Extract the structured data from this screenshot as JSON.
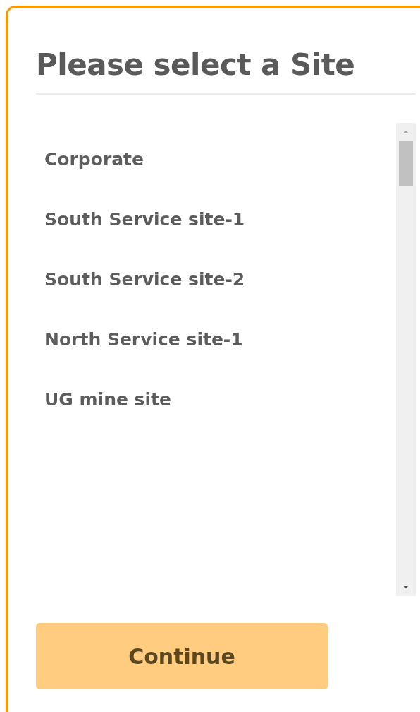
{
  "dialog": {
    "title": "Please select a Site",
    "sites": [
      {
        "label": "Corporate",
        "selected": false
      },
      {
        "label": "South Service site-1",
        "selected": false
      },
      {
        "label": "South Service site-2",
        "selected": false
      },
      {
        "label": "North Service site-1",
        "selected": false
      },
      {
        "label": "UG mine site",
        "selected": false
      }
    ],
    "button": "Continue"
  }
}
